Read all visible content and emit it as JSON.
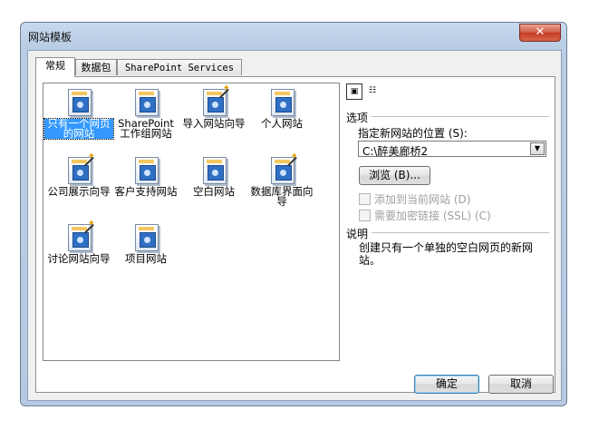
{
  "window": {
    "title": "网站模板",
    "close_label": "✕"
  },
  "tabs": [
    {
      "label": "常规",
      "active": true
    },
    {
      "label": "数据包",
      "active": false
    },
    {
      "label": "SharePoint Services",
      "active": false
    }
  ],
  "templates": [
    {
      "label": "只有一个网页的网站",
      "selected": true,
      "icon": "web-page-icon"
    },
    {
      "label": "SharePoint 工作组网站",
      "selected": false,
      "icon": "sharepoint-site-icon"
    },
    {
      "label": "导入网站向导",
      "selected": false,
      "icon": "import-wizard-icon"
    },
    {
      "label": "个人网站",
      "selected": false,
      "icon": "personal-site-icon"
    },
    {
      "label": "公司展示向导",
      "selected": false,
      "icon": "corporate-wizard-icon"
    },
    {
      "label": "客户支持网站",
      "selected": false,
      "icon": "support-site-icon"
    },
    {
      "label": "空白网站",
      "selected": false,
      "icon": "empty-site-icon"
    },
    {
      "label": "数据库界面向导",
      "selected": false,
      "icon": "database-wizard-icon"
    },
    {
      "label": "讨论网站向导",
      "selected": false,
      "icon": "discussion-wizard-icon"
    },
    {
      "label": "项目网站",
      "selected": false,
      "icon": "project-site-icon"
    }
  ],
  "options": {
    "heading": "选项",
    "location_label": "指定新网站的位置 (S):",
    "location_value": "C:\\醉美廊桥2",
    "browse_label": "浏览 (B)...",
    "add_to_current_label": "添加到当前网站 (D)",
    "encrypted_label": "需要加密链接 (SSL) (C)"
  },
  "description": {
    "heading": "说明",
    "text": "创建只有一个单独的空白网页的新网站。"
  },
  "buttons": {
    "ok": "确定",
    "cancel": "取消"
  }
}
